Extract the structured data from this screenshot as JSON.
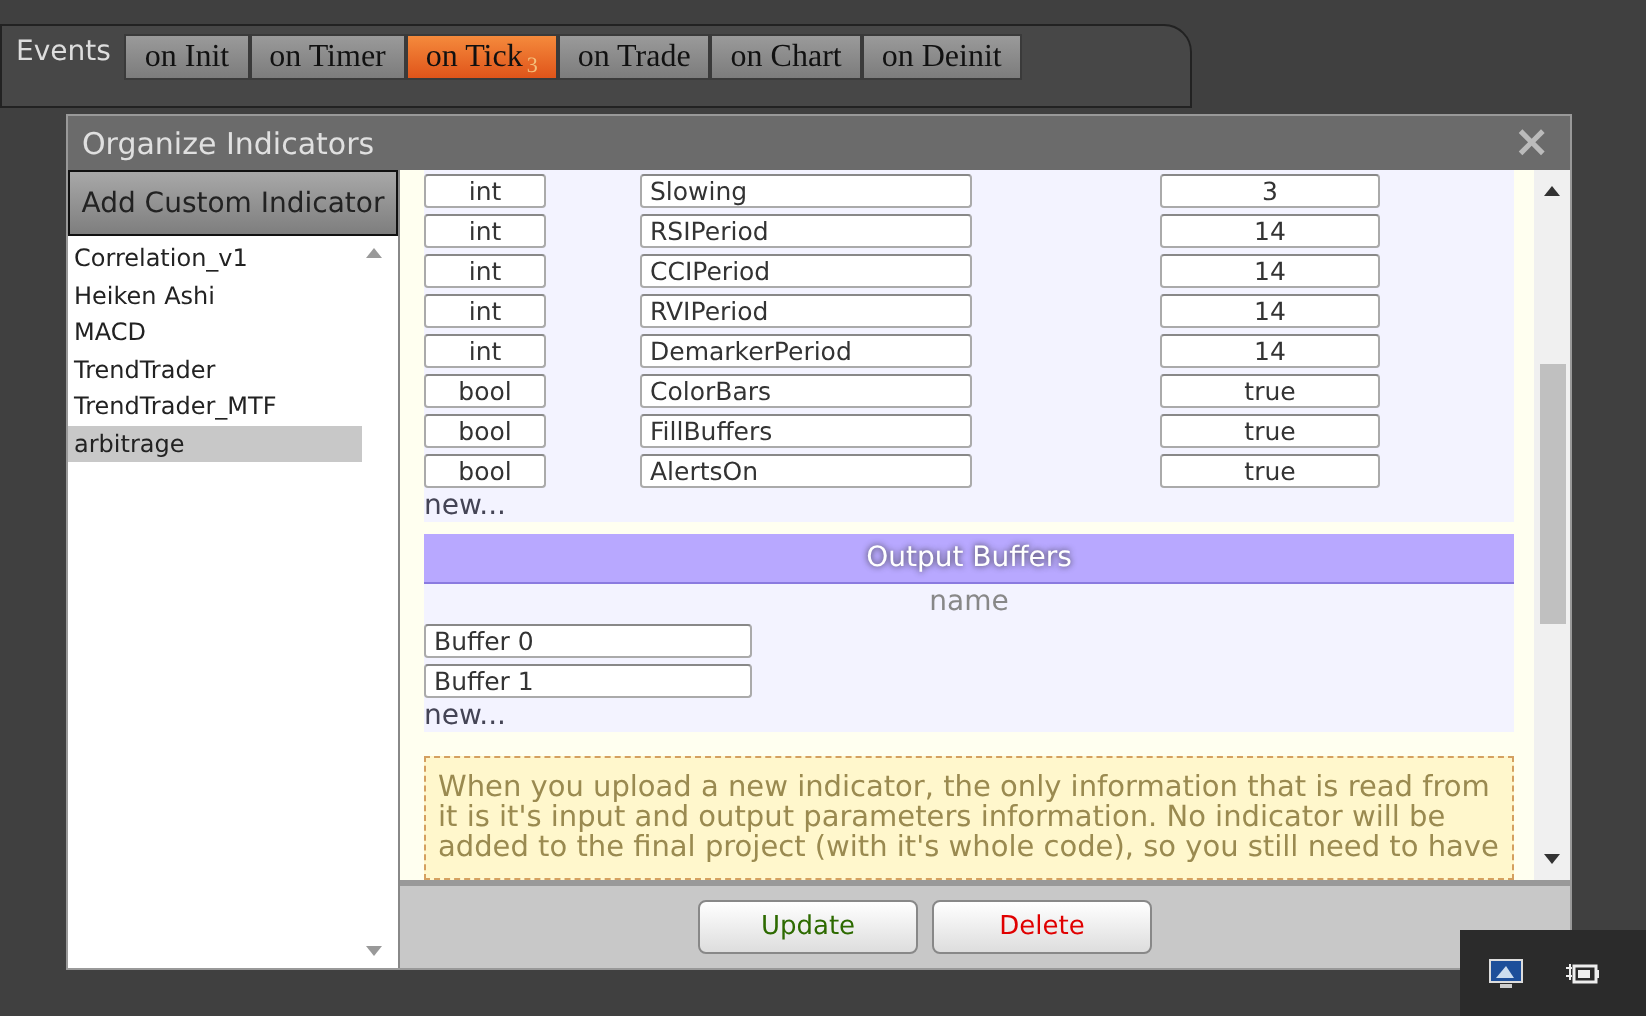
{
  "events_label": "Events",
  "tabs": [
    {
      "label": "on Init",
      "selected": false
    },
    {
      "label": "on Timer",
      "selected": false
    },
    {
      "label": "on Tick",
      "badge": "3",
      "selected": true
    },
    {
      "label": "on Trade",
      "selected": false
    },
    {
      "label": "on Chart",
      "selected": false
    },
    {
      "label": "on Deinit",
      "selected": false
    }
  ],
  "dialog": {
    "title": "Organize Indicators",
    "close": "×",
    "add_button": "Add Custom Indicator",
    "indicators": [
      {
        "name": "Correlation_v1",
        "selected": false
      },
      {
        "name": "Heiken Ashi",
        "selected": false
      },
      {
        "name": "MACD",
        "selected": false
      },
      {
        "name": "TrendTrader",
        "selected": false
      },
      {
        "name": "TrendTrader_MTF",
        "selected": false
      },
      {
        "name": "arbitrage",
        "selected": true
      }
    ],
    "inputs": {
      "rows": [
        {
          "type": "int",
          "name": "Slowing",
          "value": "3"
        },
        {
          "type": "int",
          "name": "RSIPeriod",
          "value": "14"
        },
        {
          "type": "int",
          "name": "CCIPeriod",
          "value": "14"
        },
        {
          "type": "int",
          "name": "RVIPeriod",
          "value": "14"
        },
        {
          "type": "int",
          "name": "DemarkerPeriod",
          "value": "14"
        },
        {
          "type": "bool",
          "name": "ColorBars",
          "value": "true"
        },
        {
          "type": "bool",
          "name": "FillBuffers",
          "value": "true"
        },
        {
          "type": "bool",
          "name": "AlertsOn",
          "value": "true"
        }
      ],
      "new_link": "new..."
    },
    "outputs": {
      "title": "Output Buffers",
      "column": "name",
      "rows": [
        "Buffer 0",
        "Buffer 1"
      ],
      "new_link": "new..."
    },
    "note": "When you upload a new indicator, the only information that is read from it is it's input and output parameters information. No indicator will be added to the final project (with it's whole code), so you still need to have",
    "buttons": [
      {
        "label": "Update",
        "kind": "update"
      },
      {
        "label": "Delete",
        "kind": "delete"
      }
    ]
  }
}
